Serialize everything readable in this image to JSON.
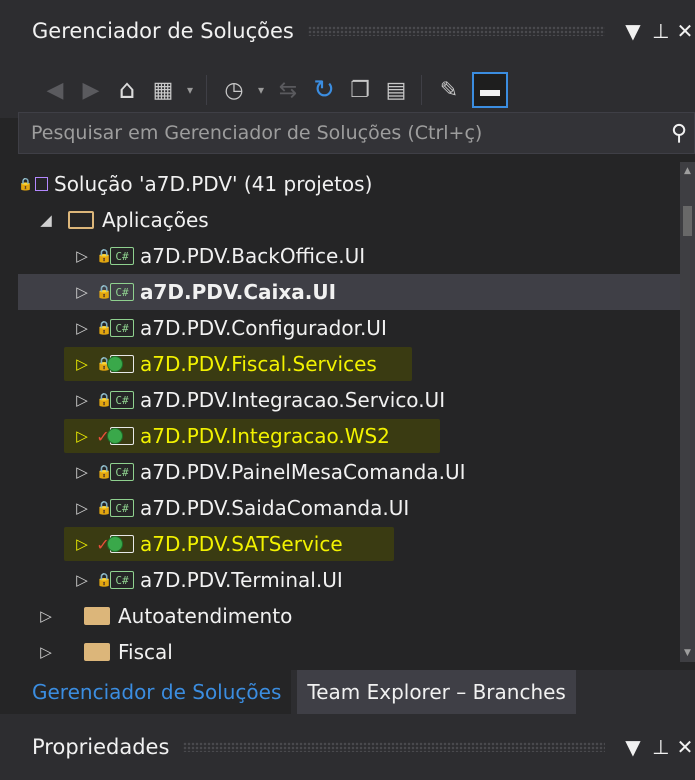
{
  "panel": {
    "title": "Gerenciador de Soluções",
    "pin_glyph": "▼",
    "pushpin_glyph": "Ⴖ",
    "close_glyph": "✕"
  },
  "toolbar": {
    "icons": [
      "back-icon",
      "forward-icon",
      "home-icon",
      "switch-views-icon",
      "pending-changes-icon",
      "sync-icon",
      "refresh-icon",
      "collapse-all-icon",
      "show-all-files-icon",
      "properties-icon",
      "preview-icon"
    ]
  },
  "search": {
    "placeholder": "Pesquisar em Gerenciador de Soluções (Ctrl+ç)"
  },
  "tree": {
    "solution": "Solução 'a7D.PDV' (41 projetos)",
    "folder_open": "Aplicações",
    "projects": [
      {
        "label": "a7D.PDV.BackOffice.UI",
        "type": "csharp",
        "status": "lock"
      },
      {
        "label": "a7D.PDV.Caixa.UI",
        "type": "csharp",
        "status": "lock",
        "bold": true
      },
      {
        "label": "a7D.PDV.Configurador.UI",
        "type": "csharp",
        "status": "lock"
      },
      {
        "label": "a7D.PDV.Fiscal.Services",
        "type": "web",
        "status": "lock",
        "highlighted": true
      },
      {
        "label": "a7D.PDV.Integracao.Servico.UI",
        "type": "csharp",
        "status": "lock"
      },
      {
        "label": "a7D.PDV.Integracao.WS2",
        "type": "web",
        "status": "check",
        "highlighted": true
      },
      {
        "label": "a7D.PDV.PainelMesaComanda.UI",
        "type": "csharp",
        "status": "lock"
      },
      {
        "label": "a7D.PDV.SaidaComanda.UI",
        "type": "csharp",
        "status": "lock"
      },
      {
        "label": "a7D.PDV.SATService",
        "type": "web",
        "status": "check",
        "highlighted": true
      },
      {
        "label": "a7D.PDV.Terminal.UI",
        "type": "csharp",
        "status": "lock"
      }
    ],
    "folders": [
      "Autoatendimento",
      "Fiscal"
    ],
    "cs_badge": "C#"
  },
  "tabs": {
    "solution_explorer": "Gerenciador de Soluções",
    "team_explorer": "Team Explorer – Branches"
  },
  "properties": {
    "title": "Propriedades"
  },
  "colors": {
    "background": "#252526",
    "accent": "#3b8de0",
    "highlight": "#f4f700"
  }
}
